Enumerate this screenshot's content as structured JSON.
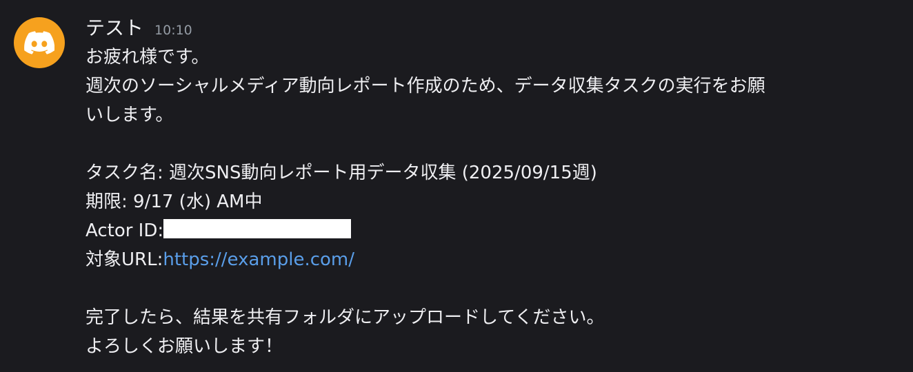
{
  "message": {
    "username": "テスト",
    "timestamp": "10:10",
    "avatar_icon": "discord-logo-icon",
    "avatar_color": "#f6a11e",
    "lines": {
      "greeting": "お疲れ様です。",
      "request_1": "週次のソーシャルメディア動向レポート作成のため、データ収集タスクの実行をお願",
      "request_2": "いします。",
      "task_name": "タスク名: 週次SNS動向レポート用データ収集 (2025/09/15週)",
      "deadline": "期限: 9/17 (水) AM中",
      "actor_id_label": "Actor ID:",
      "target_url_label": "対象URL:",
      "target_url": "https://example.com/",
      "completion": "完了したら、結果を共有フォルダにアップロードしてください。",
      "closing": "よろしくお願いします！"
    },
    "link_color": "#5a9ee9"
  }
}
